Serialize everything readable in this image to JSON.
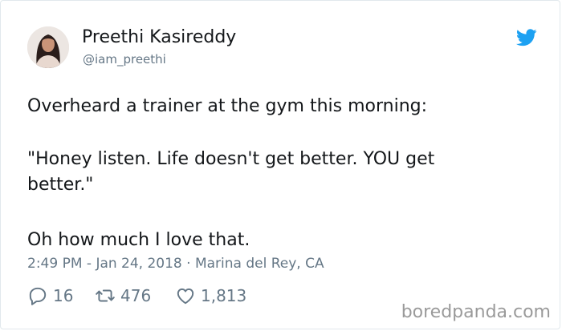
{
  "author": {
    "name": "Preethi Kasireddy",
    "handle": "@iam_preethi",
    "avatar_icon": "profile-photo"
  },
  "brand": {
    "logo_icon": "twitter-bird-icon",
    "color": "#1da1f2"
  },
  "tweet": {
    "lines": [
      "Overheard a trainer at the gym this morning:",
      "\"Honey listen. Life doesn't get better. YOU get",
      "better.\"",
      "Oh how much I love that."
    ]
  },
  "meta": {
    "line": "2:49 PM - Jan 24, 2018 · Marina del Rey, CA"
  },
  "actions": {
    "replies": {
      "icon": "reply-icon",
      "count": "16"
    },
    "retweets": {
      "icon": "retweet-icon",
      "count": "476"
    },
    "likes": {
      "icon": "heart-icon",
      "count": "1,813"
    }
  },
  "watermark": "boredpanda.com",
  "colors": {
    "text": "#14171a",
    "secondary": "#657786",
    "border": "#e1e8ed"
  }
}
